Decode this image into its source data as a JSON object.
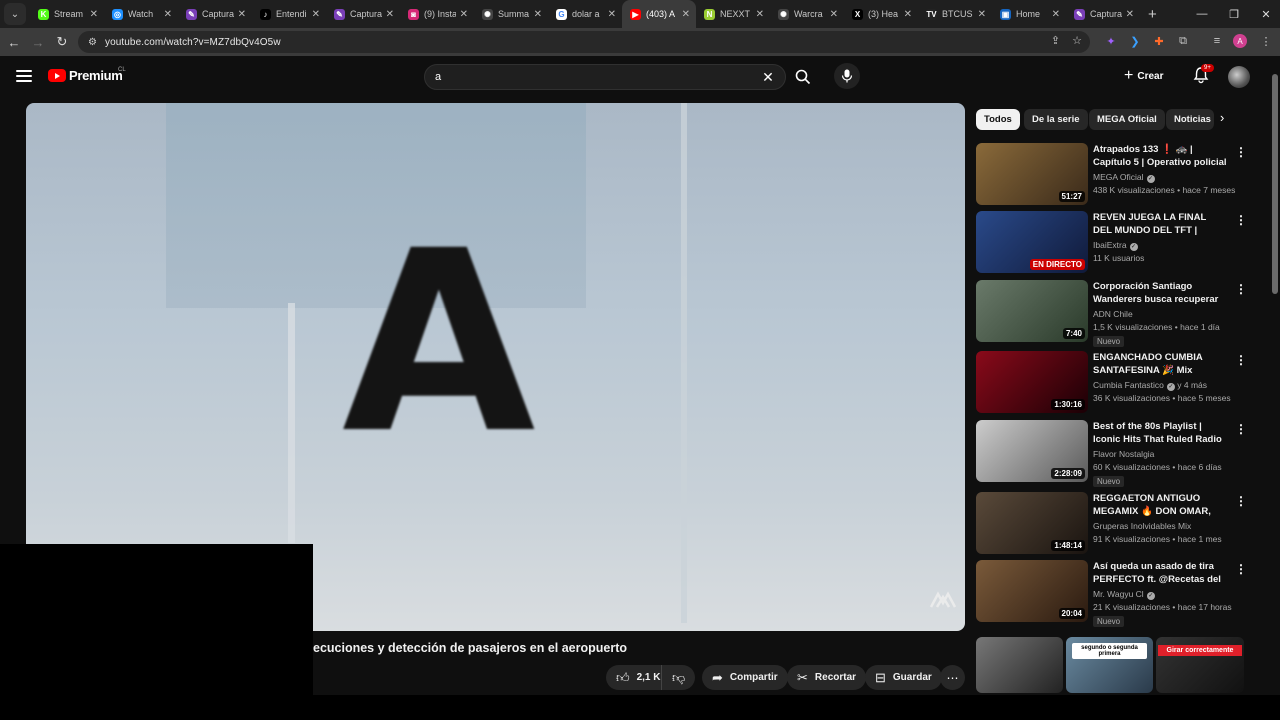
{
  "browser": {
    "tabs": [
      {
        "label": "Stream",
        "fav_color": "#53fc18",
        "fav_char": "K"
      },
      {
        "label": "Watch",
        "fav_color": "#1e90ff",
        "fav_char": "◎"
      },
      {
        "label": "Captura",
        "fav_color": "#7a3fb8",
        "fav_char": "✎"
      },
      {
        "label": "Entendi",
        "fav_color": "#000000",
        "fav_char": "♪"
      },
      {
        "label": "Captura",
        "fav_color": "#7a3fb8",
        "fav_char": "✎"
      },
      {
        "label": "(9) Insta",
        "fav_color": "#d62976",
        "fav_char": "◙"
      },
      {
        "label": "Summa",
        "fav_color": "#444444",
        "fav_char": "✺"
      },
      {
        "label": "dolar a",
        "fav_color": "#ffffff",
        "fav_char": "G"
      },
      {
        "label": "(403) A",
        "fav_color": "#ff0000",
        "fav_char": "▶"
      },
      {
        "label": "NEXXT",
        "fav_color": "#9acd32",
        "fav_char": "N"
      },
      {
        "label": "Warcra",
        "fav_color": "#444444",
        "fav_char": "✺"
      },
      {
        "label": "(3) Hea",
        "fav_color": "#000000",
        "fav_char": "X"
      },
      {
        "label": "BTCUS",
        "fav_color": "#222222",
        "fav_char": "TV"
      },
      {
        "label": "Home",
        "fav_color": "#1565c0",
        "fav_char": "▣"
      },
      {
        "label": "Captura",
        "fav_color": "#7a3fb8",
        "fav_char": "✎"
      }
    ],
    "active_tab_index": 8,
    "url": "youtube.com/watch?v=MZ7dbQv4O5w"
  },
  "header": {
    "logo_text": "Premium",
    "logo_country": "CL",
    "search_value": "a",
    "create_label": "Crear",
    "notif_badge": "9+"
  },
  "video": {
    "overlay_letter": "A",
    "title_visible": "ecuciones y detección de pasajeros en el aeropuerto",
    "likes": "2,1 K",
    "share_label": "Compartir",
    "clip_label": "Recortar",
    "save_label": "Guardar"
  },
  "chips": [
    "Todos",
    "De la serie",
    "MEGA Oficial",
    "Noticias"
  ],
  "recommendations": [
    {
      "title": "Atrapados 133 ❗ 🚓 | Capítulo 5 | Operativo policial en la ...",
      "channel": "MEGA Oficial",
      "verified": true,
      "meta": "438 K visualizaciones • hace 7 meses",
      "duration": "51:27",
      "live": false,
      "new": false,
      "thumb_bg": "linear-gradient(135deg,#8a6a3a,#3a2a1a)"
    },
    {
      "title": "REVEN JUEGA LA FINAL DEL MUNDO DEL TFT | PUEDE SER ...",
      "channel": "IbaiExtra",
      "verified": true,
      "meta": "11 K usuarios",
      "duration": "EN DIRECTO",
      "live": true,
      "new": false,
      "thumb_bg": "linear-gradient(135deg,#2a4a8a,#101a3a)"
    },
    {
      "title": "Corporación Santiago Wanderers busca recuperar el ...",
      "channel": "ADN Chile",
      "verified": false,
      "meta": "1,5 K visualizaciones • hace 1 día",
      "duration": "7:40",
      "live": false,
      "new": true,
      "thumb_bg": "linear-gradient(135deg,#6a7a6a,#2a3a2a)"
    },
    {
      "title": "ENGANCHADO CUMBIA SANTAFESINA 🎉 Mix Fiester...",
      "channel": "Cumbia Fantastico",
      "verified": true,
      "meta": "36 K visualizaciones • hace 5 meses",
      "channel_extra": "y 4 más",
      "duration": "1:30:16",
      "live": false,
      "new": false,
      "thumb_bg": "linear-gradient(135deg,#8a0a1a,#1a0005)"
    },
    {
      "title": "Best of the 80s Playlist | Iconic Hits That Ruled Radio and Pop...",
      "channel": "Flavor Nostalgia",
      "verified": false,
      "meta": "60 K visualizaciones • hace 6 días",
      "duration": "2:28:09",
      "live": false,
      "new": true,
      "thumb_bg": "linear-gradient(135deg,#cccccc,#5a5a5a)"
    },
    {
      "title": "REGGAETON ANTIGUO MEGAMIX 🔥 DON OMAR, DADD...",
      "channel": "Gruperas Inolvidables Mix",
      "verified": false,
      "meta": "91 K visualizaciones • hace 1 mes",
      "duration": "1:48:14",
      "live": false,
      "new": false,
      "thumb_bg": "linear-gradient(135deg,#5a4a3a,#1a1410)"
    },
    {
      "title": "Así queda un asado de tira PERFECTO ft. @Recetas del ...",
      "channel": "Mr. Wagyu Cl",
      "verified": true,
      "meta": "21 K visualizaciones • hace 17 horas",
      "duration": "20:04",
      "live": false,
      "new": true,
      "thumb_bg": "linear-gradient(135deg,#7a5a3a,#2a1a10)"
    }
  ],
  "shorts": [
    {
      "caption": "",
      "bg": "linear-gradient(135deg,#777,#222)"
    },
    {
      "caption": "segundo o segunda primera",
      "bg": "linear-gradient(135deg,#6a8aa0,#2a3a4a)"
    },
    {
      "caption": "Girar correctamente",
      "bg": "linear-gradient(135deg,#333,#111)"
    }
  ],
  "new_badge": "Nuevo"
}
